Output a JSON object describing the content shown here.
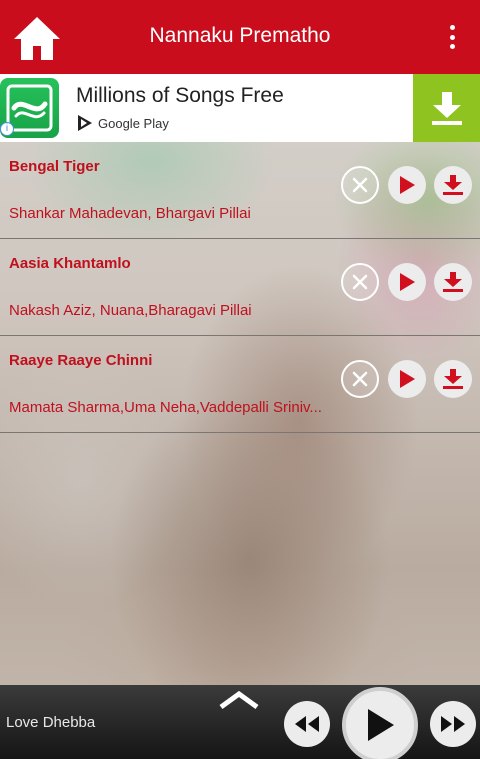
{
  "header": {
    "title": "Nannaku Prematho",
    "home_icon": "home-icon",
    "menu_icon": "overflow-menu-icon"
  },
  "ad": {
    "title": "Millions of Songs Free",
    "store_label": "Google Play",
    "info_glyph": "i",
    "download_icon": "download-icon"
  },
  "songs": [
    {
      "title": "Bengal Tiger",
      "artist": "Shankar Mahadevan, Bhargavi Pillai"
    },
    {
      "title": "Aasia Khantamlo",
      "artist": "Nakash Aziz, Nuana,Bharagavi Pillai"
    },
    {
      "title": "Raaye Raaye Chinni",
      "artist": "Mamata Sharma,Uma Neha,Vaddepalli Sriniv..."
    }
  ],
  "player": {
    "now_playing": "Love Dhebba"
  },
  "colors": {
    "brand_red": "#c90d1c",
    "text_red": "#c0101e",
    "ad_download_green": "#8fc31f",
    "saavn_green": "#1fb24f"
  }
}
